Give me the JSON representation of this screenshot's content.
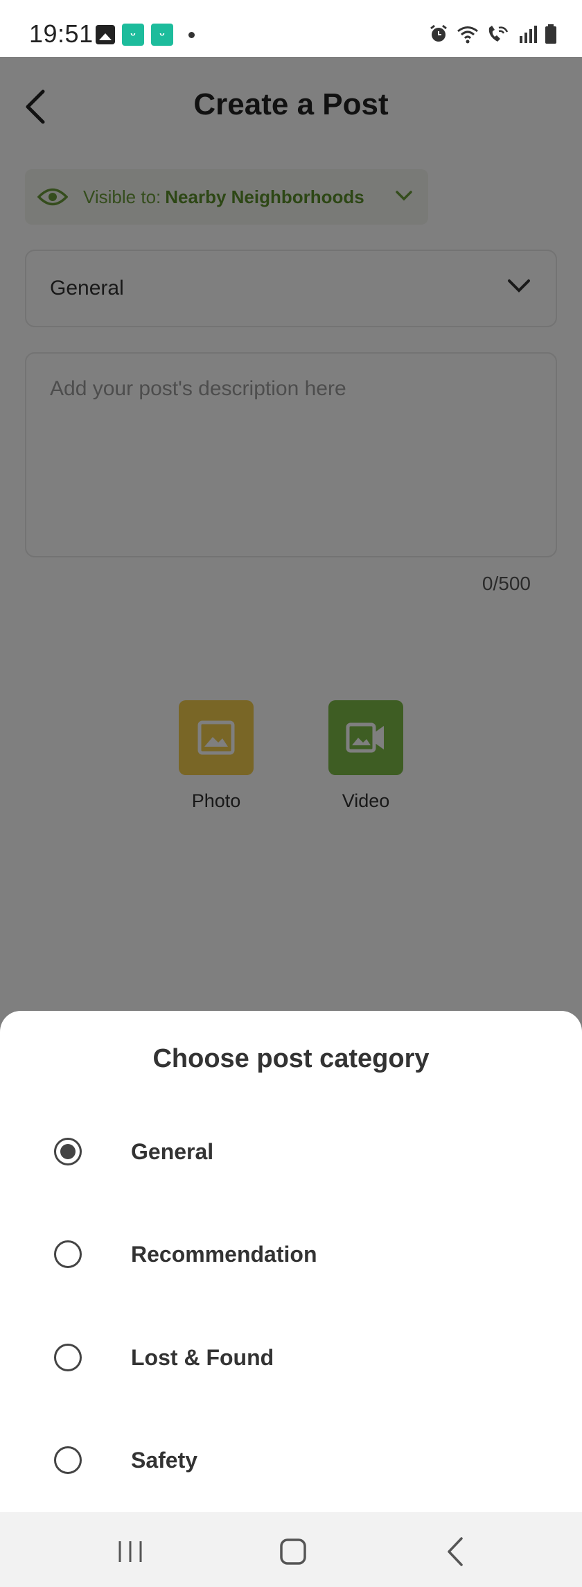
{
  "status_bar": {
    "time": "19:51",
    "left_icons": [
      "image-icon",
      "app-icon",
      "app-icon",
      "dot-icon"
    ],
    "right_icons": [
      "alarm-icon",
      "wifi-icon",
      "wifi-call-icon",
      "signal-icon",
      "battery-icon"
    ]
  },
  "header": {
    "title": "Create a Post",
    "back_icon": "chevron-left-icon"
  },
  "visibility": {
    "label": "Visible to:",
    "value": "Nearby Neighborhoods",
    "color": "#6a9a3a"
  },
  "category_select": {
    "value": "General"
  },
  "description": {
    "placeholder": "Add your post's description here",
    "value": "",
    "counter": "0/500"
  },
  "media": {
    "photo_label": "Photo",
    "video_label": "Video",
    "photo_color": "#f2cc4c",
    "video_color": "#7dbb46"
  },
  "sheet": {
    "title": "Choose post category",
    "options": [
      {
        "label": "General",
        "selected": true
      },
      {
        "label": "Recommendation",
        "selected": false
      },
      {
        "label": "Lost & Found",
        "selected": false
      },
      {
        "label": "Safety",
        "selected": false
      }
    ]
  },
  "navbar": {
    "icons": [
      "recents-icon",
      "home-icon",
      "back-icon"
    ]
  }
}
